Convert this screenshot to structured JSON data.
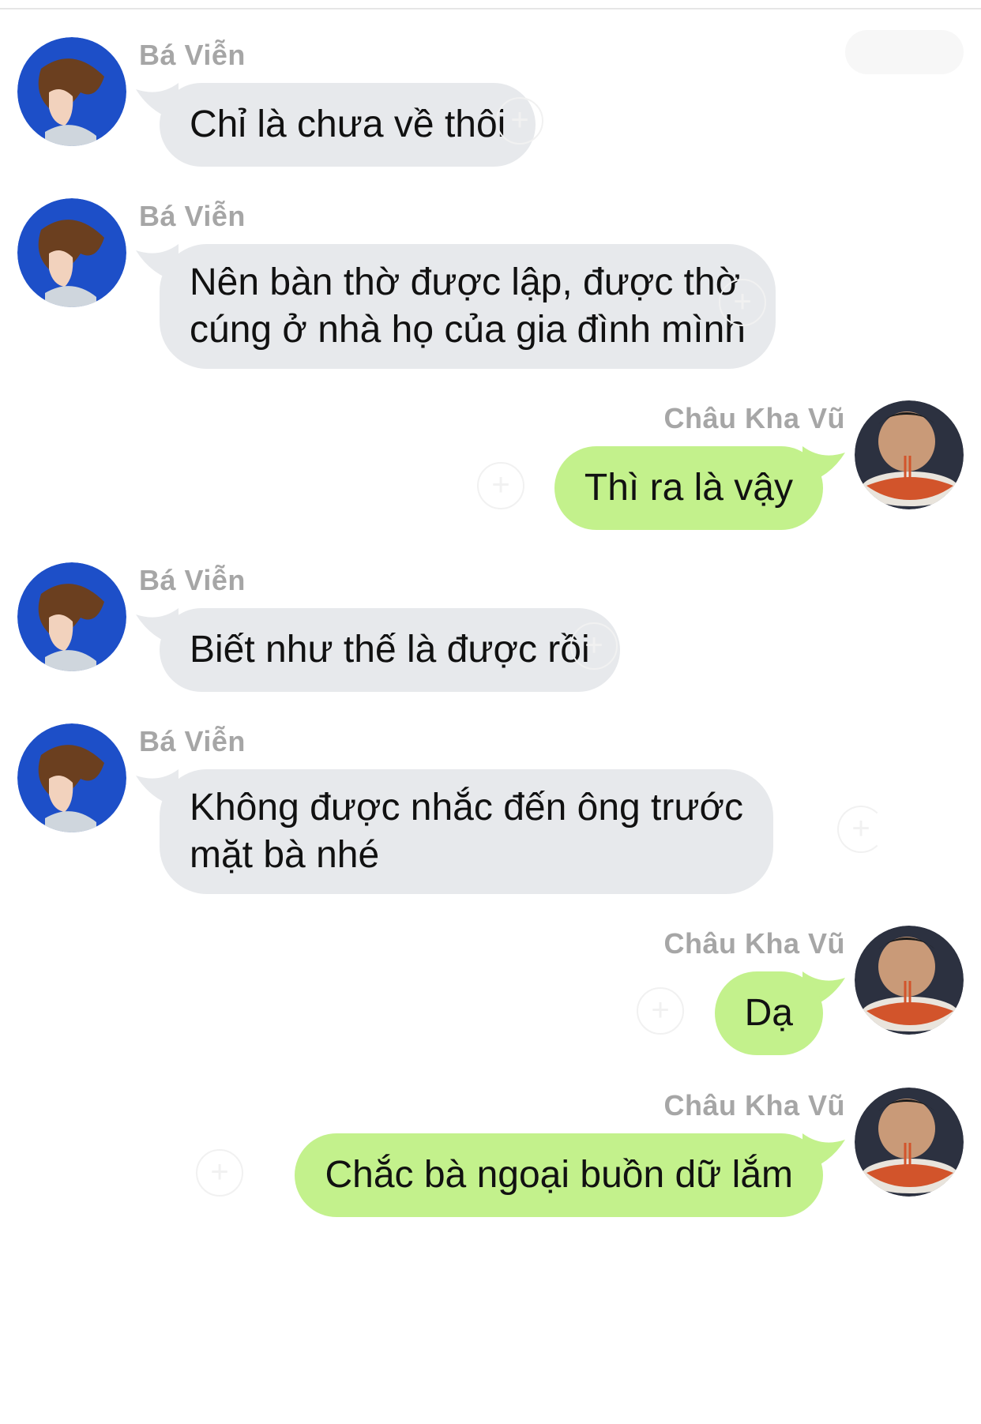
{
  "colors": {
    "incoming_bubble": "#e7e9ec",
    "outgoing_bubble": "#c3f18c",
    "sender_name": "#a6a6a6",
    "text": "#111111"
  },
  "icons": {
    "reaction_add": "plus-circle-icon"
  },
  "messages": [
    {
      "sender": "Bá Viễn",
      "direction": "incoming",
      "text": "Chỉ là chưa về thôi"
    },
    {
      "sender": "Bá Viễn",
      "direction": "incoming",
      "text": "Nên bàn thờ được lập, được thờ\ncúng ở nhà họ của gia đình mình"
    },
    {
      "sender": "Châu Kha Vũ",
      "direction": "outgoing",
      "text": "Thì ra là vậy"
    },
    {
      "sender": "Bá Viễn",
      "direction": "incoming",
      "text": "Biết như thế là được rồi"
    },
    {
      "sender": "Bá Viễn",
      "direction": "incoming",
      "text": "Không được nhắc đến ông trước\nmặt bà nhé"
    },
    {
      "sender": "Châu Kha Vũ",
      "direction": "outgoing",
      "text": "Dạ"
    },
    {
      "sender": "Châu Kha Vũ",
      "direction": "outgoing",
      "text": "Chắc bà ngoại buồn dữ lắm"
    }
  ]
}
